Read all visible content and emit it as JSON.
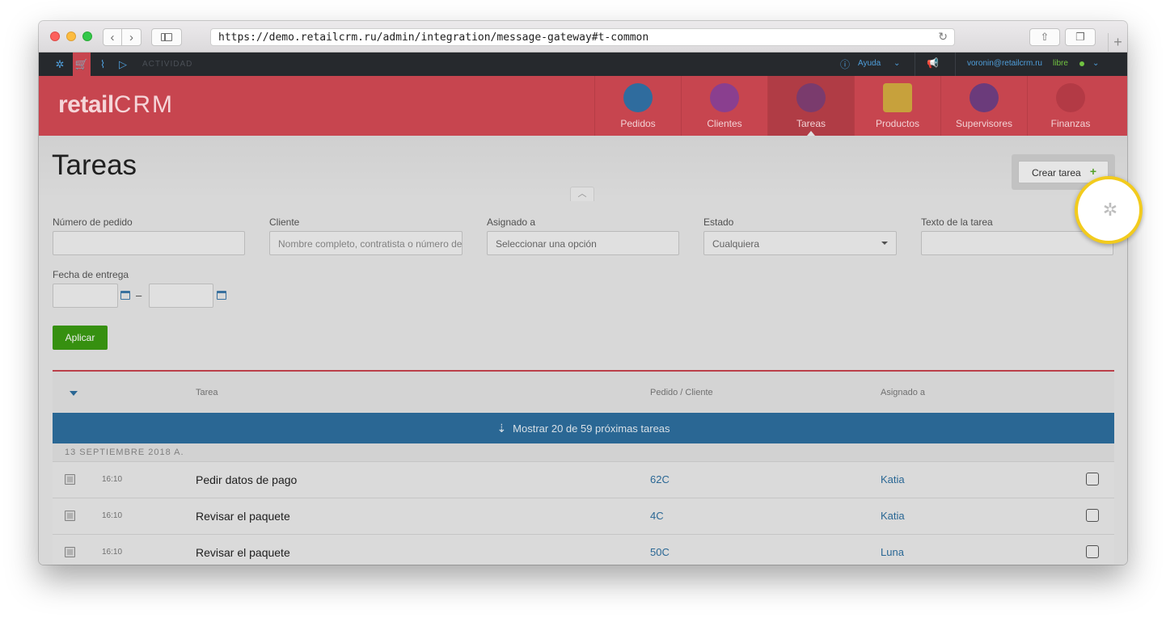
{
  "browser": {
    "url": "https://demo.retailcrm.ru/admin/integration/message-gateway#t-common",
    "back_icon": "chevron-left-icon",
    "forward_icon": "chevron-right-icon"
  },
  "topbar": {
    "activity_label": "ACTIVIDAD",
    "help_label": "Ayuda",
    "user_email": "voronin@retailcrm.ru",
    "status_label": "libre"
  },
  "header": {
    "logo_text_retail": "retail",
    "logo_text_crm": "CRM",
    "nav": [
      {
        "label": "Pedidos",
        "color": "#2f6c9e"
      },
      {
        "label": "Clientes",
        "color": "#8a3f8f"
      },
      {
        "label": "Tareas",
        "color": "#7a3b6d"
      },
      {
        "label": "Productos",
        "color": "#c7a13c"
      },
      {
        "label": "Supervisores",
        "color": "#6b3b7b"
      },
      {
        "label": "Finanzas",
        "color": "#b33a45"
      }
    ]
  },
  "page": {
    "title": "Tareas",
    "create_button": "Crear tarea",
    "create_plus": "+"
  },
  "filters": {
    "order_number_label": "Número de pedido",
    "order_number_value": "",
    "client_label": "Cliente",
    "client_placeholder": "Nombre completo, contratista o número de teléfono",
    "assigned_label": "Asignado a",
    "assigned_placeholder": "Seleccionar una opción",
    "status_label": "Estado",
    "status_value": "Cualquiera",
    "task_text_label": "Texto de la tarea",
    "task_text_value": "",
    "due_date_label": "Fecha de entrega",
    "date_separator": "–",
    "apply_button": "Aplicar"
  },
  "table": {
    "col_task": "Tarea",
    "col_order_client": "Pedido / Cliente",
    "col_assigned": "Asignado a",
    "show_more": "Mostrar 20 de 59 próximas tareas",
    "date_group": "13 SEPTIEMBRE 2018 A.",
    "rows": [
      {
        "time": "16:10",
        "task": "Pedir datos de pago",
        "order": "62C",
        "assignee": "Katia"
      },
      {
        "time": "16:10",
        "task": "Revisar el paquete",
        "order": "4C",
        "assignee": "Katia"
      },
      {
        "time": "16:10",
        "task": "Revisar el paquete",
        "order": "50C",
        "assignee": "Luna"
      }
    ]
  },
  "highlight": {
    "icon": "gear-icon",
    "ring_color": "#f2cb1d"
  }
}
